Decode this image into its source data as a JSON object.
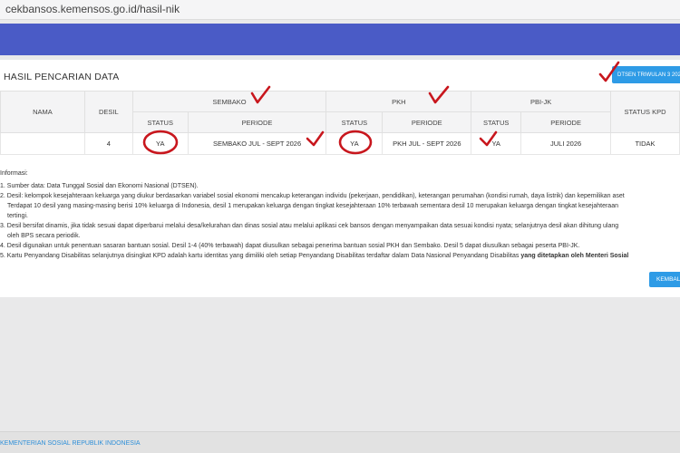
{
  "browser": {
    "url": "cekbansos.kemensos.go.id/hasil-nik"
  },
  "header": {
    "title": "HASIL PENCARIAN DATA",
    "dtsen_button": "DTSEN TRIWULAN 3 2026"
  },
  "table": {
    "col_nama": "NAMA",
    "col_desil": "DESIL",
    "group_sembako": "SEMBAKO",
    "group_pkh": "PKH",
    "group_pbi": "PBI-JK",
    "col_status_kpd": "STATUS KPD",
    "sub_status": "STATUS",
    "sub_periode": "PERIODE",
    "row": {
      "nama": "",
      "desil": "4",
      "sembako_status": "YA",
      "sembako_periode": "SEMBAKO JUL - SEPT 2026",
      "pkh_status": "YA",
      "pkh_periode": "PKH JUL - SEPT 2026",
      "pbi_status": "YA",
      "pbi_periode": "JULI 2026",
      "status_kpd": "TIDAK"
    }
  },
  "info": {
    "heading": "Informasi:",
    "item1": "1. Sumber data: Data Tunggal Sosial dan Ekonomi Nasional (DTSEN).",
    "item2": "2. Desil: kelompok kesejahteraan keluarga yang diukur berdasarkan variabel sosial ekonomi mencakup keterangan individu (pekerjaan, pendidikan), keterangan perumahan (kondisi rumah, daya listrik) dan kepemilikan aset",
    "item2_cont1": "Terdapat 10 desil yang masing-masing berisi 10% keluarga di Indonesia, desil 1 merupakan keluarga dengan tingkat kesejahteraan 10% terbawah sementara desil 10 merupakan keluarga dengan tingkat kesejahteraan",
    "item2_cont2": "tertingi.",
    "item3": "3. Desil bersifat dinamis, jika tidak sesuai dapat diperbarui melalui desa/kelurahan dan dinas sosial atau melalui aplikasi cek bansos dengan menyampaikan data sesuai kondisi nyata; selanjutnya desil akan dihitung ulang",
    "item3_cont": "oleh BPS secara periodik.",
    "item4": "4. Desil digunakan untuk penentuan sasaran bantuan sosial. Desil 1-4 (40% terbawah) dapat diusulkan sebagai penerima bantuan sosial PKH dan Sembako. Desil 5 dapat diusulkan sebagai peserta PBI-JK.",
    "item5": "5. Kartu Penyandang Disabilitas selanjutnya disingkat KPD adalah kartu identitas yang dimiliki oleh setiap Penyandang Disabilitas terdaftar dalam Data Nasional Penyandang Disabilitas",
    "item5_bold": " yang ditetapkan oleh Menteri Sosial"
  },
  "kembali_button": "KEMBALI",
  "footer": {
    "text": "KEMENTERIAN SOSIAL REPUBLIK INDONESIA"
  },
  "colors": {
    "topbar": "#4a5bc6",
    "button": "#2e9be6",
    "annotation": "#c8161d"
  }
}
